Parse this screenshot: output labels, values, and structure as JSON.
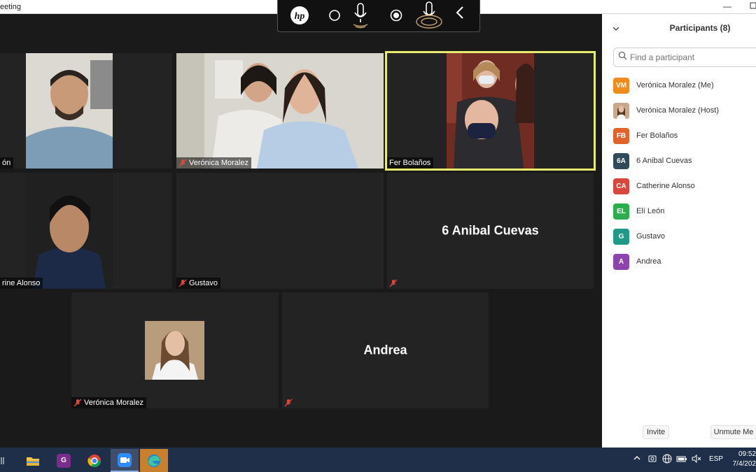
{
  "window": {
    "title": "eeting",
    "minimize": "—"
  },
  "hp_toolbar": {
    "logo": "hp"
  },
  "tiles": [
    {
      "name": "ón",
      "muted": false
    },
    {
      "name": "Verónica Moralez",
      "muted": true
    },
    {
      "name": "Fer Bolaños",
      "muted": false
    },
    {
      "name": "rine Alonso",
      "muted": false
    },
    {
      "name": "Gustavo",
      "muted": true
    },
    {
      "name": "",
      "big_name": "6 Anibal Cuevas",
      "muted": true
    },
    {
      "name": "Verónica Moralez",
      "muted": true
    },
    {
      "name": "",
      "big_name": "Andrea",
      "muted": true
    }
  ],
  "panel": {
    "title": "Participants (8)",
    "search_placeholder": "Find a participant",
    "participants": [
      {
        "initials": "VM",
        "name": "Verónica Moralez (Me)",
        "color": "#f08c1e"
      },
      {
        "initials": "",
        "name": "Verónica Moralez (Host)",
        "color": "#b98a6a"
      },
      {
        "initials": "FB",
        "name": "Fer Bolaños",
        "color": "#e2632a"
      },
      {
        "initials": "6A",
        "name": "6 Anibal Cuevas",
        "color": "#304a5a"
      },
      {
        "initials": "CA",
        "name": "Catherine Alonso",
        "color": "#d9463e"
      },
      {
        "initials": "EL",
        "name": "Elí León",
        "color": "#2cad4e"
      },
      {
        "initials": "G",
        "name": "Gustavo",
        "color": "#1f9a87"
      },
      {
        "initials": "A",
        "name": "Andrea",
        "color": "#8e44ad"
      }
    ],
    "invite_label": "Invite",
    "unmute_label": "Unmute Me"
  },
  "taskbar": {
    "lang": "ESP",
    "time": "09:52",
    "date": "7/4/202"
  }
}
